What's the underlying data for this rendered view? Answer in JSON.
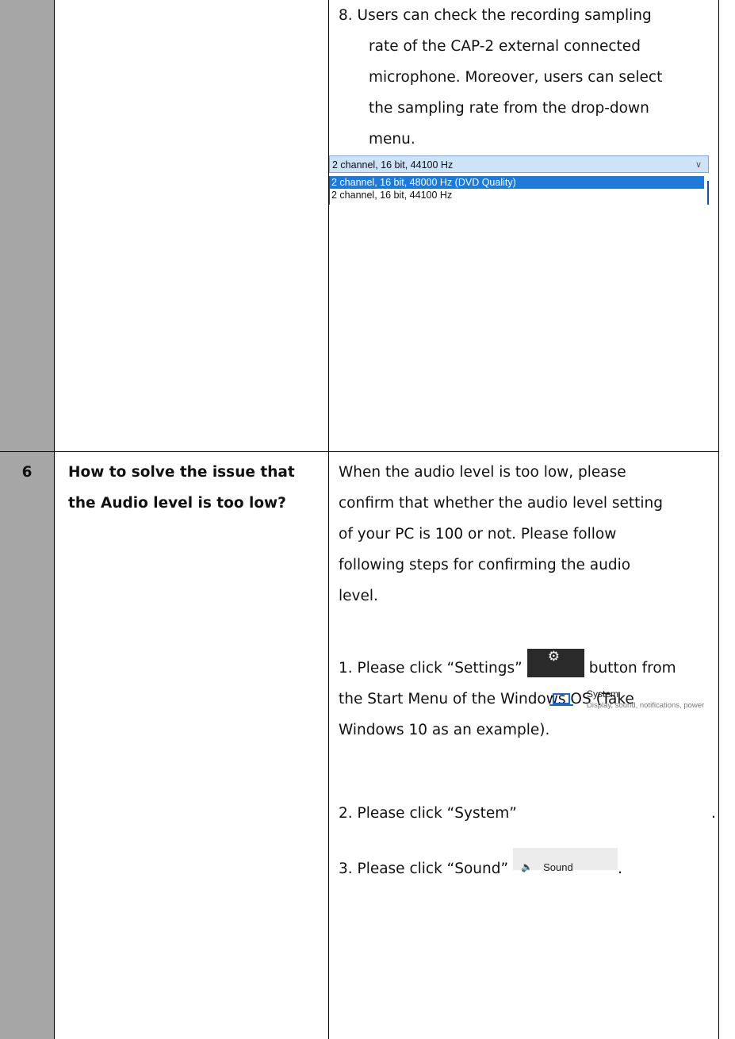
{
  "item8": {
    "lines": [
      "8. Users can check the recording sampling",
      "rate of the CAP-2 external connected",
      "microphone. Moreover, users can select",
      "the sampling rate from the drop-down",
      "menu."
    ]
  },
  "dropdown": {
    "selected": "2 channel, 16 bit, 44100 Hz",
    "options": [
      "2 channel, 16 bit, 48000 Hz (DVD Quality)",
      "2 channel, 16 bit, 44100 Hz"
    ]
  },
  "row6": {
    "number": "6",
    "question_lines": [
      "How to solve the issue that",
      "the Audio level is too low?"
    ],
    "answer_lines": [
      "When the audio level is too low, please",
      "confirm that whether the audio level setting",
      "of your PC is 100 or not. Please follow",
      "following steps for confirming the audio",
      "level."
    ],
    "step1_before": "1. Please click “Settings”",
    "step1_after": "button from",
    "step1_lines": [
      "the Start Menu of the Windows OS (Take",
      "Windows 10 as an example)."
    ],
    "step2_text": "2. Please click “System”",
    "step2_end": ".",
    "step3_text": "3. Please click “Sound”",
    "step3_end": "."
  },
  "system_widget": {
    "title": "System",
    "subtitle": "Display, sound, notifications, power"
  },
  "sound_widget": {
    "label": "Sound"
  }
}
